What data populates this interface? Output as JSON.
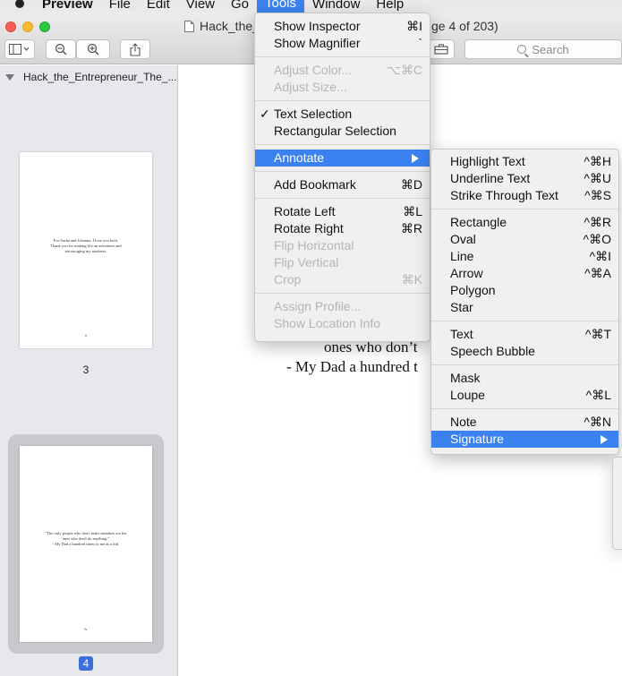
{
  "menubar": {
    "items": [
      {
        "label": "Preview"
      },
      {
        "label": "File"
      },
      {
        "label": "Edit"
      },
      {
        "label": "View"
      },
      {
        "label": "Go"
      },
      {
        "label": "Tools"
      },
      {
        "label": "Window"
      },
      {
        "label": "Help"
      }
    ]
  },
  "toolbar": {
    "doc_title": "Hack_the_",
    "page_indicator": "ge 4 of 203)",
    "search_placeholder": "Search"
  },
  "sidebar": {
    "header": "Hack_the_Entrepreneur_The_...",
    "page3": {
      "text": "For Sasha and Johanna, I love you both.\nThank you for making life an adventure and\nencouraging my madness.",
      "footer": "ii",
      "label": "3"
    },
    "page4": {
      "text": "\"The only people who don't make mistakes are the\nones who don't do anything.\"\n- My Dad a hundred times to me as a kid.",
      "footer": "iv",
      "label": "4"
    }
  },
  "document": {
    "line1": "ones who don’t",
    "line2": "- My Dad a hundred t"
  },
  "tools_menu": {
    "show_inspector": {
      "label": "Show Inspector",
      "shortcut": "⌘I"
    },
    "show_magnifier": {
      "label": "Show Magnifier",
      "shortcut": "`"
    },
    "adjust_color": {
      "label": "Adjust Color...",
      "shortcut": "⌥⌘C"
    },
    "adjust_size": {
      "label": "Adjust Size..."
    },
    "text_selection": {
      "label": "Text Selection",
      "check": "✓"
    },
    "rect_selection": {
      "label": "Rectangular Selection"
    },
    "annotate": {
      "label": "Annotate"
    },
    "add_bookmark": {
      "label": "Add Bookmark",
      "shortcut": "⌘D"
    },
    "rotate_left": {
      "label": "Rotate Left",
      "shortcut": "⌘L"
    },
    "rotate_right": {
      "label": "Rotate Right",
      "shortcut": "⌘R"
    },
    "flip_horizontal": {
      "label": "Flip Horizontal"
    },
    "flip_vertical": {
      "label": "Flip Vertical"
    },
    "crop": {
      "label": "Crop",
      "shortcut": "⌘K"
    },
    "assign_profile": {
      "label": "Assign Profile..."
    },
    "show_location": {
      "label": "Show Location Info"
    }
  },
  "annotate_menu": {
    "highlight": {
      "label": "Highlight Text",
      "shortcut": "^⌘H"
    },
    "underline": {
      "label": "Underline Text",
      "shortcut": "^⌘U"
    },
    "strike": {
      "label": "Strike Through Text",
      "shortcut": "^⌘S"
    },
    "rectangle": {
      "label": "Rectangle",
      "shortcut": "^⌘R"
    },
    "oval": {
      "label": "Oval",
      "shortcut": "^⌘O"
    },
    "line": {
      "label": "Line",
      "shortcut": "^⌘I"
    },
    "arrow": {
      "label": "Arrow",
      "shortcut": "^⌘A"
    },
    "polygon": {
      "label": "Polygon"
    },
    "star": {
      "label": "Star"
    },
    "text": {
      "label": "Text",
      "shortcut": "^⌘T"
    },
    "speech_bubble": {
      "label": "Speech Bubble"
    },
    "mask": {
      "label": "Mask"
    },
    "loupe": {
      "label": "Loupe",
      "shortcut": "^⌘L"
    },
    "note": {
      "label": "Note",
      "shortcut": "^⌘N"
    },
    "signature": {
      "label": "Signature"
    }
  },
  "colors": {
    "accent": "#3b82f0",
    "sidebar_bg": "#e6e8ee",
    "disabled_text": "#b5b5b5"
  }
}
